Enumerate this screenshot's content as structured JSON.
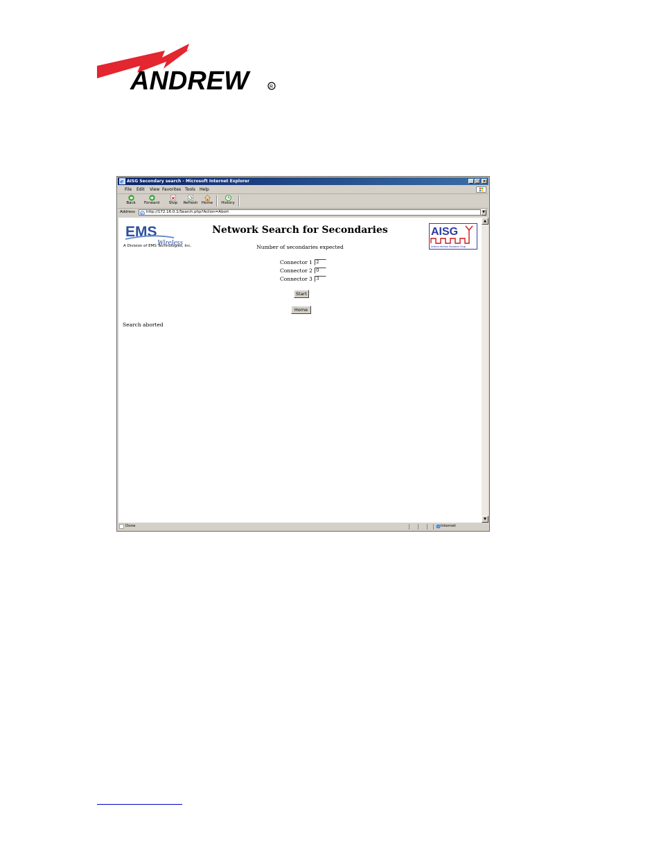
{
  "document": {
    "logo_text": "ANDREW"
  },
  "browser": {
    "window_title": "AISG Secondary search - Microsoft Internet Explorer",
    "menu": [
      "File",
      "Edit",
      "View",
      "Favorites",
      "Tools",
      "Help"
    ],
    "toolbar": {
      "back": "Back",
      "forward": "Forward",
      "stop": "Stop",
      "refresh": "Refresh",
      "home": "Home",
      "history": "History"
    },
    "address_label": "Address",
    "address_url": "http://172.16.0.1/Search.php?Action=Abort",
    "status_text": "Done",
    "status_zone": "Internet"
  },
  "page": {
    "ems_logo_text": "EMS",
    "ems_logo_sub": "Wireless",
    "ems_division": "A Division of EMS Technologies, Inc.",
    "heading": "Network Search for Secondaries",
    "aisg_logo_text": "AISG",
    "aisg_tagline": "Antenna Interface Standards Group",
    "expected_label": "Number of secondaries expected",
    "connectors": [
      {
        "label": "Connector 1",
        "value": "2"
      },
      {
        "label": "Connector 2",
        "value": "0"
      },
      {
        "label": "Connector 3",
        "value": "3"
      }
    ],
    "start_button": "Start",
    "home_button": "Home",
    "status_message": "Search aborted"
  },
  "colors": {
    "andrew_red": "#e3262f",
    "ems_blue": "#2d4f9e",
    "aisg_red": "#d01818",
    "titlebar_blue": "#0a246a"
  }
}
